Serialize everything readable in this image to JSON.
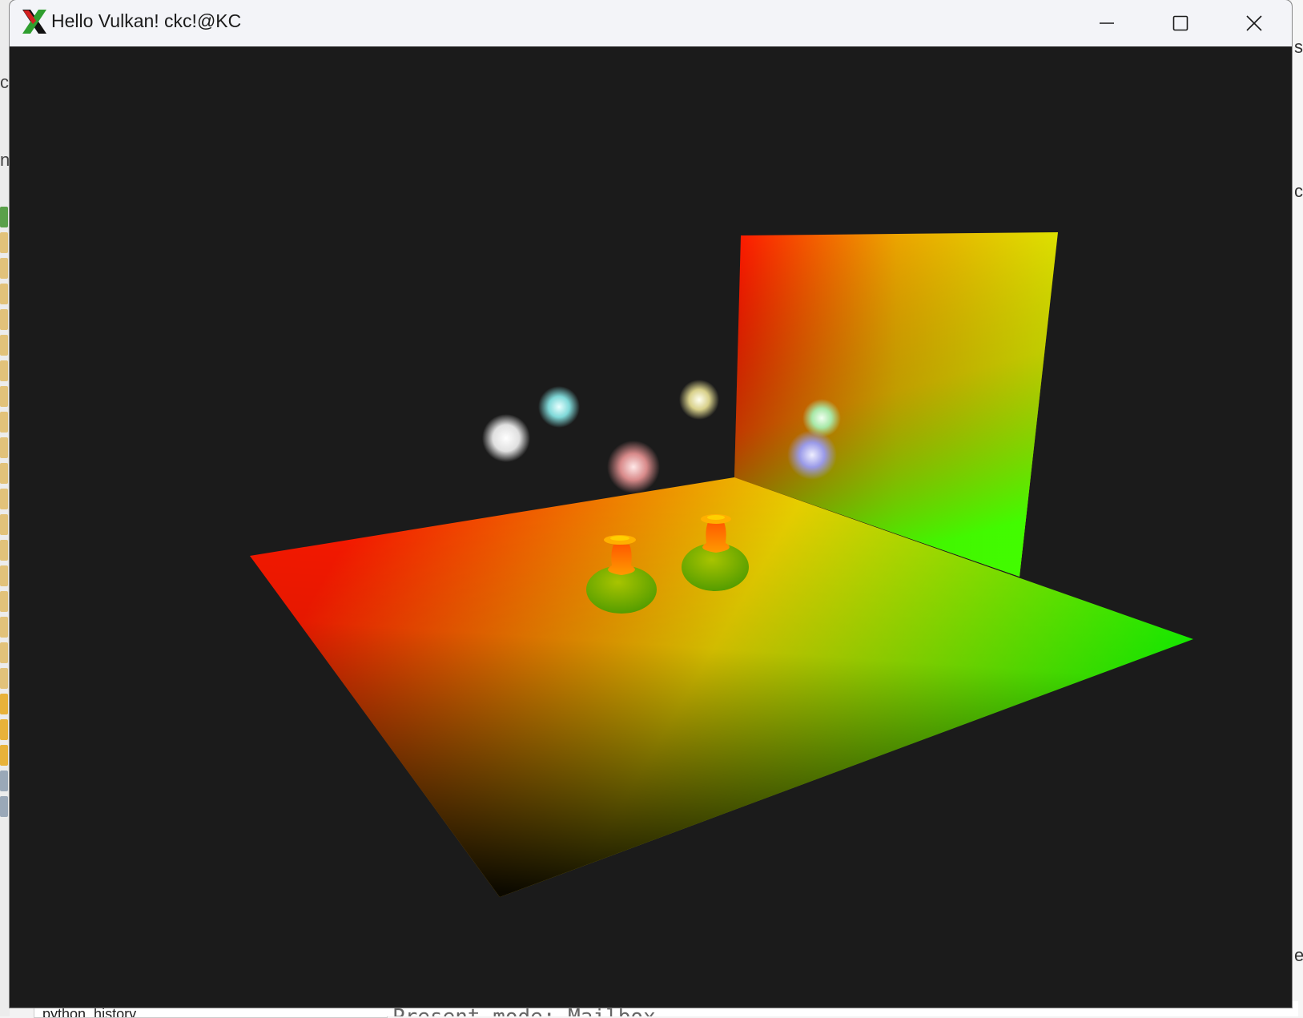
{
  "window": {
    "title": "Hello Vulkan! ckc!@KC",
    "icon": "x-app-icon",
    "controls": [
      "minimize-icon",
      "maximize-icon",
      "close-icon"
    ]
  },
  "scene": {
    "objects": [
      "ground-plane",
      "back-wall",
      "vase-left",
      "vase-right"
    ],
    "lights": [
      {
        "name": "light-white",
        "color": "#e8e8e8"
      },
      {
        "name": "light-cyan",
        "color": "#8fe0e0"
      },
      {
        "name": "light-yellow",
        "color": "#e8e0a0"
      },
      {
        "name": "light-pink",
        "color": "#e89a9a"
      },
      {
        "name": "light-green",
        "color": "#a8e8a8"
      },
      {
        "name": "light-blue",
        "color": "#a8a8f0"
      }
    ],
    "colors": {
      "red": "#ff2a00",
      "yellow": "#ffff00",
      "green": "#00ff00",
      "black": "#000000"
    }
  },
  "background": {
    "left_fragments": [
      "cc",
      "n"
    ],
    "right_fragments": [
      "s",
      "c",
      "e"
    ],
    "file_item": "python_history",
    "console_text": "Present mode: Mailbox"
  }
}
